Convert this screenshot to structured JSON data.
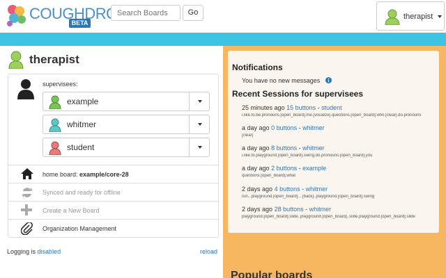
{
  "header": {
    "brand": "COUGHDROP",
    "badge": "BETA",
    "search_placeholder": "Search Boards",
    "go_label": "Go",
    "user_name": "therapist"
  },
  "left": {
    "title": "therapist",
    "supervisees_label": "supervisees:",
    "supervisees": [
      {
        "name": "example",
        "avatar_color": "#7cc35a"
      },
      {
        "name": "whitmer",
        "avatar_color": "#5cc7c4"
      },
      {
        "name": "student",
        "avatar_color": "#e77a7a"
      }
    ],
    "home_board_label": "home board: ",
    "home_board_value": "example/core-28",
    "synced": "Synced and ready for offline",
    "create_board": "Create a New Board",
    "org_mgmt": "Organization Management",
    "logging_prefix": "Logging is ",
    "logging_state": "disabled",
    "reload": "reload"
  },
  "right": {
    "notifications_title": "Notifications",
    "no_messages": "You have no new messages",
    "recent_title": "Recent Sessions for supervisees",
    "sessions": [
      {
        "time": "25 minutes ago",
        "buttons": "15 buttons",
        "user": "student",
        "detail": "i.like.to.be.pronouns.[open_board].me.[vocalize].questions.[open_board].who.[clear].do.pronouns"
      },
      {
        "time": "a day ago",
        "buttons": "0 buttons",
        "user": "whitmer",
        "detail": "[clear]"
      },
      {
        "time": "a day ago",
        "buttons": "8 buttons",
        "user": "whitmer",
        "detail": "i.like.to.playground.[open_board].swing.do.pronouns.[open_board].you"
      },
      {
        "time": "a day ago",
        "buttons": "2 buttons",
        "user": "example",
        "detail": "questions.[open_board].what"
      },
      {
        "time": "2 days ago",
        "buttons": "4 buttons",
        "user": "whitmer",
        "detail": "run...playground.[open_board]....[back]..playground.[open_board].swing"
      },
      {
        "time": "2 days ago",
        "buttons": "28 buttons",
        "user": "whitmer",
        "detail": "playground.[open_board].slide..playground.[open_board]..slide.playground.[open_board].slide"
      }
    ],
    "popular_title": "Popular boards"
  },
  "colors": {
    "accent": "#2a77b6",
    "bar": "#3ec3e5",
    "right_bg": "#f6b760"
  },
  "icons": [
    "logo-icon",
    "avatar-icon",
    "person-icon",
    "home-icon",
    "sync-icon",
    "plus-icon",
    "paperclip-icon",
    "info-icon",
    "caret-down-icon"
  ]
}
